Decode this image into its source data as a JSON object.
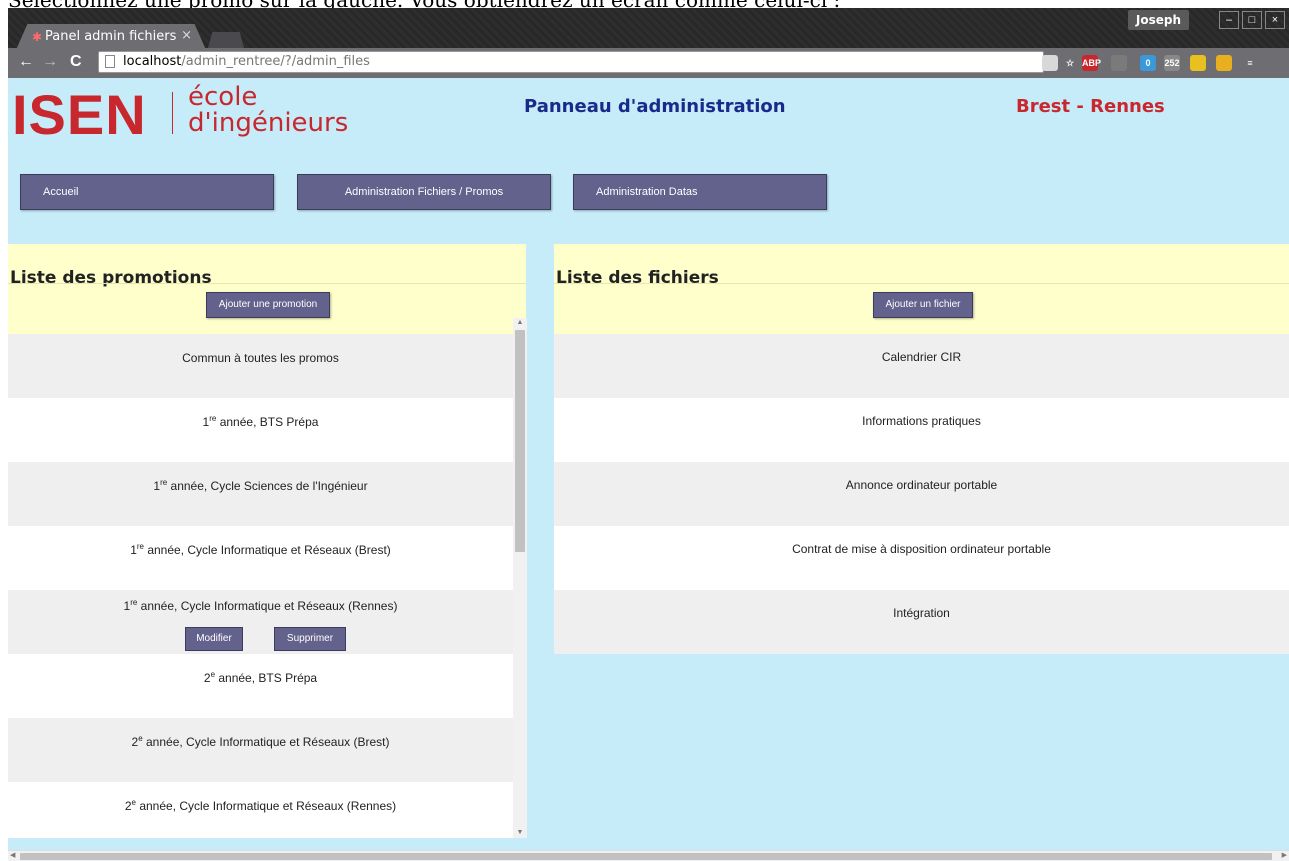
{
  "caption": "Sélectionnez une promo sur la gauche. Vous obtiendrez un écran comme celui-ci :",
  "browser": {
    "tab_title": "Panel admin fichiers",
    "tab_close": "×",
    "user": "Joseph",
    "url_host": "localhost",
    "url_path": "/admin_rentree/?/admin_files",
    "window_controls": [
      "–",
      "□",
      "×"
    ],
    "extensions": [
      {
        "name": "lightbulb-icon",
        "label": "",
        "color": "#d8d8d8"
      },
      {
        "name": "star-icon",
        "label": "☆",
        "color": "#6d6d72"
      },
      {
        "name": "adblock-icon",
        "label": "ABP",
        "color": "#c8282d"
      },
      {
        "name": "reader-icon",
        "label": "",
        "color": "#7a7a7a"
      },
      {
        "name": "ghostery-icon",
        "label": "0",
        "color": "#3a9ad9"
      },
      {
        "name": "rss-icon",
        "label": "252",
        "color": "#888"
      },
      {
        "name": "shield-icon",
        "label": "",
        "color": "#e8c020"
      },
      {
        "name": "face-icon",
        "label": "",
        "color": "#e8b020"
      },
      {
        "name": "menu-icon",
        "label": "≡",
        "color": "#6d6d72"
      }
    ]
  },
  "header": {
    "logo_isen": "ISEN",
    "logo_line1": "école",
    "logo_line2": "d'ingénieurs",
    "title": "Panneau d'administration",
    "campus": "Brest - Rennes"
  },
  "menu": [
    "Accueil",
    "Administration Fichiers / Promos",
    "Administration Datas"
  ],
  "promos": {
    "heading": "Liste des promotions",
    "add_label": "Ajouter une promotion",
    "items": [
      {
        "pre": "Commun à toutes les promos",
        "sup": "",
        "post": ""
      },
      {
        "pre": "1",
        "sup": "re",
        "post": " année, BTS Prépa"
      },
      {
        "pre": "1",
        "sup": "re",
        "post": " année, Cycle Sciences de l'Ingénieur"
      },
      {
        "pre": "1",
        "sup": "re",
        "post": " année, Cycle Informatique et Réseaux (Brest)"
      },
      {
        "pre": "1",
        "sup": "re",
        "post": " année, Cycle Informatique et Réseaux (Rennes)"
      },
      {
        "pre": "2",
        "sup": "e",
        "post": " année, BTS Prépa"
      },
      {
        "pre": "2",
        "sup": "e",
        "post": " année, Cycle Informatique et Réseaux (Brest)"
      },
      {
        "pre": "2",
        "sup": "e",
        "post": " année, Cycle Informatique et Réseaux (Rennes)"
      }
    ],
    "selected_index": 4,
    "edit_label": "Modifier",
    "delete_label": "Supprimer"
  },
  "files": {
    "heading": "Liste des fichiers",
    "add_label": "Ajouter un fichier",
    "items": [
      "Calendrier CIR",
      "Informations pratiques",
      "Annonce ordinateur portable",
      "Contrat de mise à disposition ordinateur portable",
      "Intégration"
    ]
  },
  "colors": {
    "page_bg": "#c6ecfa",
    "accent_red": "#c8282d",
    "button_bg": "#62628c",
    "panel_header_bg": "#ffffcc",
    "row_alt": "#efefef",
    "row": "#ffffff"
  }
}
